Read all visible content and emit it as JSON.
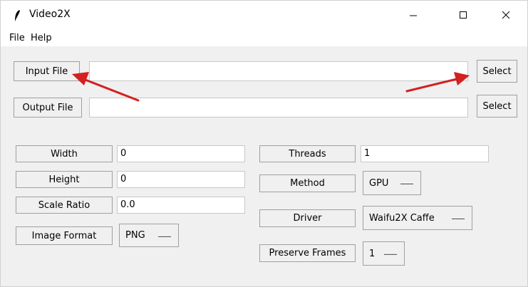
{
  "window": {
    "title": "Video2X",
    "controls": {
      "minimize": "—",
      "maximize": "☐",
      "close": "✕"
    }
  },
  "menu": {
    "file": "File",
    "help": "Help"
  },
  "files": {
    "input_button": "Input File",
    "input_value": "",
    "input_select": "Select",
    "output_button": "Output File",
    "output_value": "",
    "output_select": "Select"
  },
  "settings": {
    "width_label": "Width",
    "width_value": "0",
    "height_label": "Height",
    "height_value": "0",
    "scale_label": "Scale Ratio",
    "scale_value": "0.0",
    "format_label": "Image Format",
    "format_value": "PNG",
    "threads_label": "Threads",
    "threads_value": "1",
    "method_label": "Method",
    "method_value": "GPU",
    "driver_label": "Driver",
    "driver_value": "Waifu2X Caffe",
    "preserve_label": "Preserve Frames",
    "preserve_value": "1"
  },
  "colors": {
    "annotation_arrow": "#d42020",
    "window_bg": "#f0f0f0"
  },
  "icons": {
    "app": "feather-icon"
  }
}
